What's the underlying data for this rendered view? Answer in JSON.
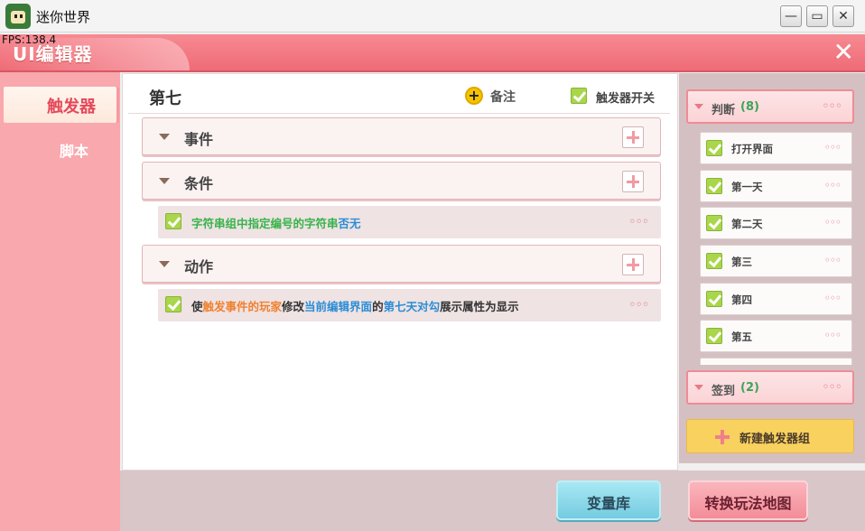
{
  "window": {
    "title": "迷你世界",
    "minimize": "—",
    "maximize": "▭",
    "close": "✕",
    "fps": "FPS:138.4"
  },
  "editor": {
    "title": "UI编辑器",
    "close": "✕"
  },
  "sidebar": {
    "tabs": [
      {
        "label": "触发器",
        "active": true
      },
      {
        "label": "脚本",
        "active": false
      }
    ]
  },
  "trigger": {
    "name": "第七",
    "note_label": "备注",
    "note_icon": "plus-circle-icon",
    "switch_label": "触发器开关",
    "switch_checked": true,
    "sections": {
      "event": {
        "name": "事件"
      },
      "condition": {
        "name": "条件",
        "row": [
          "字符串组中指定编号的字符串",
          "否无"
        ]
      },
      "action": {
        "name": "动作",
        "row": [
          "使",
          "触发事件的玩家",
          "修改",
          "当前编辑界面",
          "的",
          "第七天对勾",
          "展示属性为显示"
        ]
      }
    },
    "more": "◦◦◦"
  },
  "groups": [
    {
      "name": "判断",
      "count": "(8)",
      "more": "◦◦◦"
    },
    {
      "name": "签到",
      "count": "(2)",
      "more": "◦◦◦"
    }
  ],
  "triggers": [
    {
      "name": "打开界面",
      "checked": true
    },
    {
      "name": "第一天",
      "checked": true
    },
    {
      "name": "第二天",
      "checked": true
    },
    {
      "name": "第三",
      "checked": true
    },
    {
      "name": "第四",
      "checked": true
    },
    {
      "name": "第五",
      "checked": true
    }
  ],
  "trigger_more": "◦◦◦",
  "new_group": "新建触发器组",
  "bottom": {
    "variables": "变量库",
    "switch_map": "转换玩法地图"
  },
  "colors": {
    "header": "#ee6b76",
    "accent_green": "#37b34a",
    "accent_blue": "#2a8dd6",
    "accent_orange": "#f0802e"
  }
}
